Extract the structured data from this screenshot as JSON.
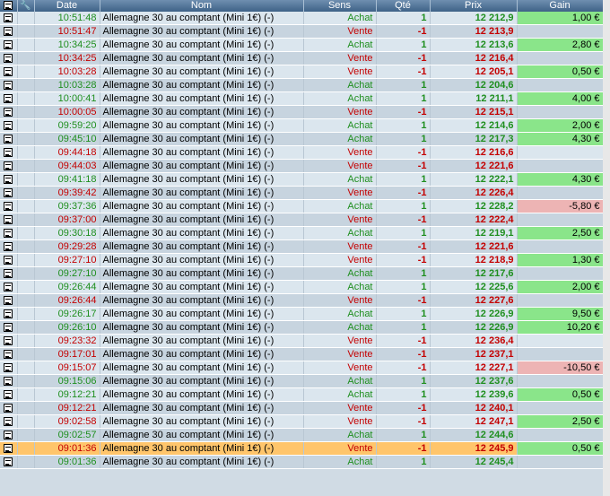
{
  "headers": {
    "icon1": "",
    "icon2": "🔧",
    "date": "Date",
    "name": "Nom",
    "sens": "Sens",
    "qty": "Qté",
    "prix": "Prix",
    "gain": "Gain"
  },
  "colors": {
    "buy": "#1f8f1f",
    "sell": "#c40000",
    "gain_pos": "#8ae58a",
    "gain_neg": "#edb4b4",
    "selected": "#ffc56b"
  },
  "rows": [
    {
      "time": "10:51:48",
      "name": "Allemagne 30 au comptant (Mini 1€) (-)",
      "sens": "Achat",
      "qty": "1",
      "prix": "12 212,9",
      "gain": "1,00 €"
    },
    {
      "time": "10:51:47",
      "name": "Allemagne 30 au comptant (Mini 1€) (-)",
      "sens": "Vente",
      "qty": "-1",
      "prix": "12 213,9",
      "gain": ""
    },
    {
      "time": "10:34:25",
      "name": "Allemagne 30 au comptant (Mini 1€) (-)",
      "sens": "Achat",
      "qty": "1",
      "prix": "12 213,6",
      "gain": "2,80 €"
    },
    {
      "time": "10:34:25",
      "name": "Allemagne 30 au comptant (Mini 1€) (-)",
      "sens": "Vente",
      "qty": "-1",
      "prix": "12 216,4",
      "gain": ""
    },
    {
      "time": "10:03:28",
      "name": "Allemagne 30 au comptant (Mini 1€) (-)",
      "sens": "Vente",
      "qty": "-1",
      "prix": "12 205,1",
      "gain": "0,50 €"
    },
    {
      "time": "10:03:28",
      "name": "Allemagne 30 au comptant (Mini 1€) (-)",
      "sens": "Achat",
      "qty": "1",
      "prix": "12 204,6",
      "gain": ""
    },
    {
      "time": "10:00:41",
      "name": "Allemagne 30 au comptant (Mini 1€) (-)",
      "sens": "Achat",
      "qty": "1",
      "prix": "12 211,1",
      "gain": "4,00 €"
    },
    {
      "time": "10:00:05",
      "name": "Allemagne 30 au comptant (Mini 1€) (-)",
      "sens": "Vente",
      "qty": "-1",
      "prix": "12 215,1",
      "gain": ""
    },
    {
      "time": "09:59:20",
      "name": "Allemagne 30 au comptant (Mini 1€) (-)",
      "sens": "Achat",
      "qty": "1",
      "prix": "12 214,6",
      "gain": "2,00 €"
    },
    {
      "time": "09:45:10",
      "name": "Allemagne 30 au comptant (Mini 1€) (-)",
      "sens": "Achat",
      "qty": "1",
      "prix": "12 217,3",
      "gain": "4,30 €"
    },
    {
      "time": "09:44:18",
      "name": "Allemagne 30 au comptant (Mini 1€) (-)",
      "sens": "Vente",
      "qty": "-1",
      "prix": "12 216,6",
      "gain": ""
    },
    {
      "time": "09:44:03",
      "name": "Allemagne 30 au comptant (Mini 1€) (-)",
      "sens": "Vente",
      "qty": "-1",
      "prix": "12 221,6",
      "gain": ""
    },
    {
      "time": "09:41:18",
      "name": "Allemagne 30 au comptant (Mini 1€) (-)",
      "sens": "Achat",
      "qty": "1",
      "prix": "12 222,1",
      "gain": "4,30 €"
    },
    {
      "time": "09:39:42",
      "name": "Allemagne 30 au comptant (Mini 1€) (-)",
      "sens": "Vente",
      "qty": "-1",
      "prix": "12 226,4",
      "gain": ""
    },
    {
      "time": "09:37:36",
      "name": "Allemagne 30 au comptant (Mini 1€) (-)",
      "sens": "Achat",
      "qty": "1",
      "prix": "12 228,2",
      "gain": "-5,80 €"
    },
    {
      "time": "09:37:00",
      "name": "Allemagne 30 au comptant (Mini 1€) (-)",
      "sens": "Vente",
      "qty": "-1",
      "prix": "12 222,4",
      "gain": ""
    },
    {
      "time": "09:30:18",
      "name": "Allemagne 30 au comptant (Mini 1€) (-)",
      "sens": "Achat",
      "qty": "1",
      "prix": "12 219,1",
      "gain": "2,50 €"
    },
    {
      "time": "09:29:28",
      "name": "Allemagne 30 au comptant (Mini 1€) (-)",
      "sens": "Vente",
      "qty": "-1",
      "prix": "12 221,6",
      "gain": ""
    },
    {
      "time": "09:27:10",
      "name": "Allemagne 30 au comptant (Mini 1€) (-)",
      "sens": "Vente",
      "qty": "-1",
      "prix": "12 218,9",
      "gain": "1,30 €"
    },
    {
      "time": "09:27:10",
      "name": "Allemagne 30 au comptant (Mini 1€) (-)",
      "sens": "Achat",
      "qty": "1",
      "prix": "12 217,6",
      "gain": ""
    },
    {
      "time": "09:26:44",
      "name": "Allemagne 30 au comptant (Mini 1€) (-)",
      "sens": "Achat",
      "qty": "1",
      "prix": "12 225,6",
      "gain": "2,00 €"
    },
    {
      "time": "09:26:44",
      "name": "Allemagne 30 au comptant (Mini 1€) (-)",
      "sens": "Vente",
      "qty": "-1",
      "prix": "12 227,6",
      "gain": ""
    },
    {
      "time": "09:26:17",
      "name": "Allemagne 30 au comptant (Mini 1€) (-)",
      "sens": "Achat",
      "qty": "1",
      "prix": "12 226,9",
      "gain": "9,50 €"
    },
    {
      "time": "09:26:10",
      "name": "Allemagne 30 au comptant (Mini 1€) (-)",
      "sens": "Achat",
      "qty": "1",
      "prix": "12 226,9",
      "gain": "10,20 €"
    },
    {
      "time": "09:23:32",
      "name": "Allemagne 30 au comptant (Mini 1€) (-)",
      "sens": "Vente",
      "qty": "-1",
      "prix": "12 236,4",
      "gain": ""
    },
    {
      "time": "09:17:01",
      "name": "Allemagne 30 au comptant (Mini 1€) (-)",
      "sens": "Vente",
      "qty": "-1",
      "prix": "12 237,1",
      "gain": ""
    },
    {
      "time": "09:15:07",
      "name": "Allemagne 30 au comptant (Mini 1€) (-)",
      "sens": "Vente",
      "qty": "-1",
      "prix": "12 227,1",
      "gain": "-10,50 €"
    },
    {
      "time": "09:15:06",
      "name": "Allemagne 30 au comptant (Mini 1€) (-)",
      "sens": "Achat",
      "qty": "1",
      "prix": "12 237,6",
      "gain": ""
    },
    {
      "time": "09:12:21",
      "name": "Allemagne 30 au comptant (Mini 1€) (-)",
      "sens": "Achat",
      "qty": "1",
      "prix": "12 239,6",
      "gain": "0,50 €"
    },
    {
      "time": "09:12:21",
      "name": "Allemagne 30 au comptant (Mini 1€) (-)",
      "sens": "Vente",
      "qty": "-1",
      "prix": "12 240,1",
      "gain": ""
    },
    {
      "time": "09:02:58",
      "name": "Allemagne 30 au comptant (Mini 1€) (-)",
      "sens": "Vente",
      "qty": "-1",
      "prix": "12 247,1",
      "gain": "2,50 €"
    },
    {
      "time": "09:02:57",
      "name": "Allemagne 30 au comptant (Mini 1€) (-)",
      "sens": "Achat",
      "qty": "1",
      "prix": "12 244,6",
      "gain": ""
    },
    {
      "time": "09:01:36",
      "name": "Allemagne 30 au comptant (Mini 1€) (-)",
      "sens": "Vente",
      "qty": "-1",
      "prix": "12 245,9",
      "gain": "0,50 €",
      "selected": true
    },
    {
      "time": "09:01:36",
      "name": "Allemagne 30 au comptant (Mini 1€) (-)",
      "sens": "Achat",
      "qty": "1",
      "prix": "12 245,4",
      "gain": ""
    }
  ]
}
